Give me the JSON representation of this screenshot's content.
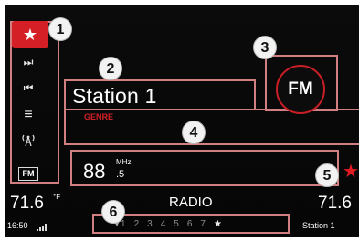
{
  "sidebar": {
    "items": [
      {
        "name": "favorite-button",
        "glyph": "★"
      },
      {
        "name": "seek-forward-button",
        "glyph": "⏭"
      },
      {
        "name": "seek-back-button",
        "glyph": "⏮"
      },
      {
        "name": "menu-button",
        "glyph": "≡"
      },
      {
        "name": "tower-icon",
        "glyph": "📡"
      },
      {
        "name": "fm-button",
        "glyph": "FM"
      }
    ]
  },
  "callouts": [
    "1",
    "2",
    "3",
    "4",
    "5",
    "6"
  ],
  "station": {
    "name": "Station 1",
    "genre": "GENRE",
    "band": "FM",
    "frequency_main": "88",
    "frequency_decimal": ".5",
    "frequency_unit": "MHz"
  },
  "status": {
    "temp_left": "71.6",
    "temp_unit": "°F",
    "temp_right": "71.6",
    "title": "RADIO",
    "clock": "16:50",
    "station_small": "Station 1"
  },
  "presets": {
    "numbers": [
      "1",
      "2",
      "3",
      "4",
      "5",
      "6",
      "7"
    ],
    "star": "★",
    "arrow": "▼"
  },
  "colors": {
    "accent_red": "#d41f26",
    "highlight_pink": "#d08080",
    "background": "#080808"
  }
}
